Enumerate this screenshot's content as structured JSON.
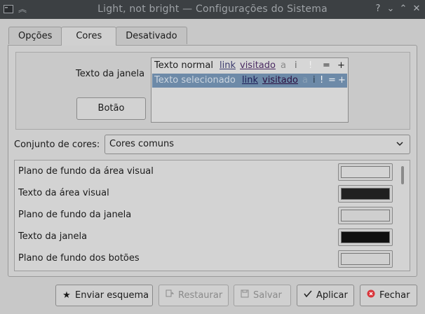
{
  "window": {
    "title": "Light, not bright — Configurações do Sistema",
    "buttons": {
      "help": "?",
      "minimize": "⌄",
      "maximize": "⌃",
      "close": "✕"
    }
  },
  "tabs": [
    {
      "label": "Opções"
    },
    {
      "label": "Cores"
    },
    {
      "label": "Desativado"
    }
  ],
  "preview": {
    "window_text_label": "Texto da janela",
    "button_label": "Botão",
    "normal_row": {
      "text": "Texto normal",
      "link": "link",
      "visited": "visitado",
      "a": "a",
      "i": "i",
      "excl": "!",
      "eq": "=",
      "plus": "+"
    },
    "selected_row": {
      "text": "Texto selecionado",
      "link": "link",
      "visited": "visitado",
      "a": "a",
      "i": "i",
      "excl": "!",
      "eq": "=",
      "plus": "+"
    }
  },
  "scheme": {
    "label": "Conjunto de cores:",
    "selected": "Cores comuns"
  },
  "color_items": [
    {
      "label": "Plano de fundo da área visual",
      "color": "#d4d4d4"
    },
    {
      "label": "Texto da área visual",
      "color": "#202020"
    },
    {
      "label": "Plano de fundo da janela",
      "color": "#cfcfcf"
    },
    {
      "label": "Texto da janela",
      "color": "#0f0f0f"
    },
    {
      "label": "Plano de fundo dos botões",
      "color": "#d0d0d0"
    }
  ],
  "footer": {
    "send": "Enviar esquema",
    "restore": "Restaurar",
    "save": "Salvar",
    "apply": "Aplicar",
    "close": "Fechar"
  },
  "colors": {
    "titlebar": "#3c4043",
    "selection": "#6d8aa8",
    "close_icon": "#d9353b"
  }
}
